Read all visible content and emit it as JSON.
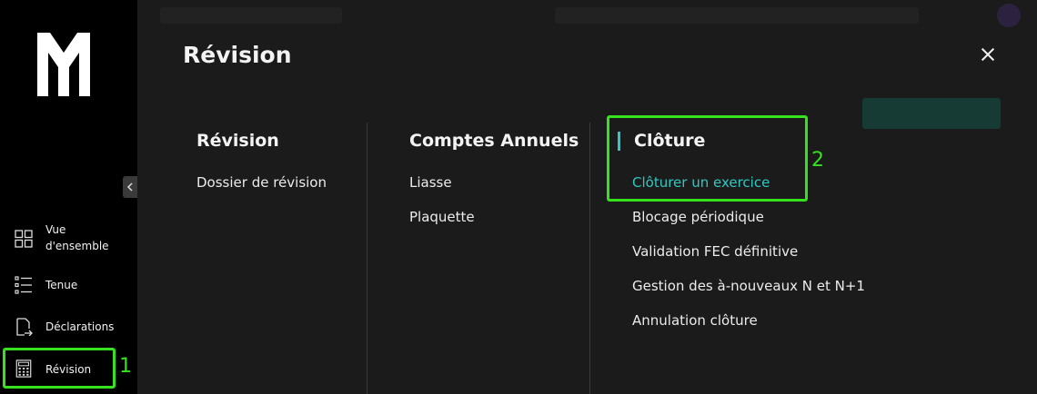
{
  "sidebar": {
    "logo": "M-logo",
    "collapse_icon": "chevron-left-icon",
    "items": [
      {
        "label_line1": "Vue",
        "label_line2": "d'ensemble",
        "icon": "grid-icon"
      },
      {
        "label": "Tenue",
        "icon": "list-icon"
      },
      {
        "label": "Déclarations",
        "icon": "document-arrow-icon"
      },
      {
        "label": "Révision",
        "icon": "calculator-icon",
        "active": true
      }
    ]
  },
  "annotations": {
    "marker1": "1",
    "marker2": "2",
    "color": "#35e21d"
  },
  "panel": {
    "title": "Révision",
    "close_icon": "close-icon",
    "accent_color": "#2ec9c2",
    "columns": [
      {
        "heading": "Révision",
        "links": [
          "Dossier de révision"
        ]
      },
      {
        "heading": "Comptes Annuels",
        "links": [
          "Liasse",
          "Plaquette"
        ]
      },
      {
        "heading": "Clôture",
        "links": [
          "Clôturer un exercice",
          "Blocage périodique",
          "Validation FEC définitive",
          "Gestion des à-nouveaux N et N+1",
          "Annulation clôture"
        ],
        "active_index": 0
      }
    ]
  }
}
